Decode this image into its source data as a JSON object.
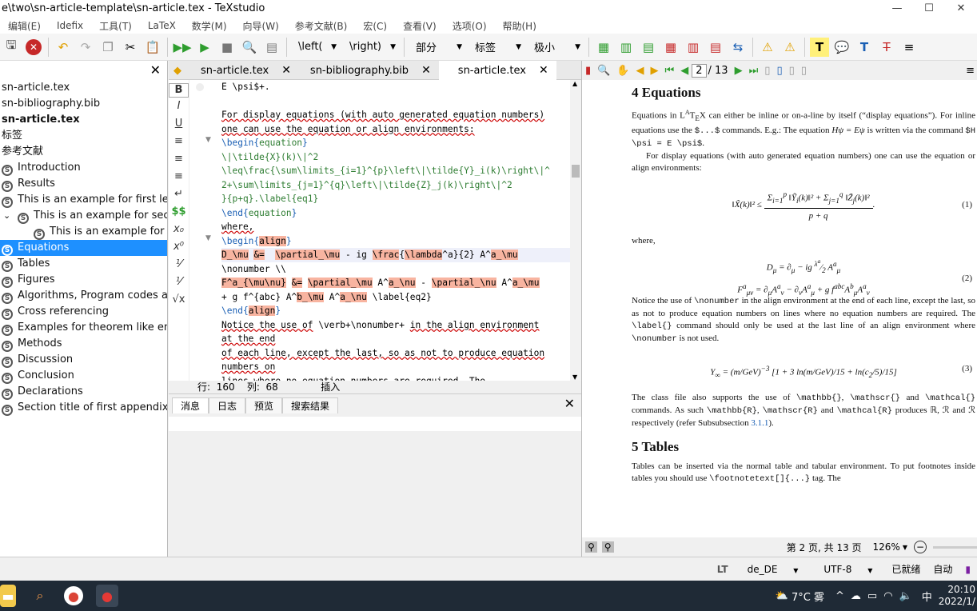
{
  "window": {
    "title": "e\\two\\sn-article-template\\sn-article.tex - TeXstudio",
    "controls": [
      "—",
      "☐",
      "✕"
    ]
  },
  "menu": [
    "编辑(E)",
    "Idefix",
    "工具(T)",
    "LaTeX",
    "数学(M)",
    "向导(W)",
    "参考文献(B)",
    "宏(C)",
    "查看(V)",
    "选项(O)",
    "帮助(H)"
  ],
  "toolbar": {
    "left_combo": "\\left(",
    "right_combo": "\\right)",
    "section_combo": "部分",
    "label_combo": "标签",
    "size_combo": "极小"
  },
  "tree": {
    "items": [
      {
        "label": "sn-article.tex",
        "bold": false,
        "indent": 0,
        "icon": false
      },
      {
        "label": "sn-bibliography.bib",
        "bold": false,
        "indent": 0,
        "icon": false
      },
      {
        "label": "sn-article.tex",
        "bold": true,
        "indent": 0,
        "icon": false
      },
      {
        "label": "标签",
        "bold": false,
        "indent": 0,
        "icon": false
      },
      {
        "label": "参考文献",
        "bold": false,
        "indent": 0,
        "icon": false
      },
      {
        "label": "Introduction",
        "indent": 0,
        "icon": true
      },
      {
        "label": "Results",
        "indent": 0,
        "icon": true
      },
      {
        "label": "This is an example for first lev...",
        "indent": 0,
        "icon": true
      },
      {
        "label": "This is an example for sec...",
        "indent": 1,
        "icon": true,
        "expand": "⌄"
      },
      {
        "label": "This is an example for ...",
        "indent": 2,
        "icon": true
      },
      {
        "label": "Equations",
        "indent": 0,
        "icon": true,
        "selected": true
      },
      {
        "label": "Tables",
        "indent": 0,
        "icon": true
      },
      {
        "label": "Figures",
        "indent": 0,
        "icon": true
      },
      {
        "label": "Algorithms, Program codes a...",
        "indent": 0,
        "icon": true
      },
      {
        "label": "Cross referencing",
        "indent": 0,
        "icon": true
      },
      {
        "label": "Examples for theorem like en...",
        "indent": 0,
        "icon": true
      },
      {
        "label": "Methods",
        "indent": 0,
        "icon": true
      },
      {
        "label": "Discussion",
        "indent": 0,
        "icon": true
      },
      {
        "label": "Conclusion",
        "indent": 0,
        "icon": true
      },
      {
        "label": "Declarations",
        "indent": 0,
        "icon": true
      },
      {
        "label": "Section title of first appendix",
        "indent": 0,
        "icon": true
      }
    ]
  },
  "editor": {
    "tabs": [
      {
        "label": "sn-article.tex",
        "active": false
      },
      {
        "label": "sn-bibliography.bib",
        "active": false
      },
      {
        "label": "sn-article.tex",
        "active": true
      }
    ],
    "status": {
      "line_label": "行:",
      "line": "160",
      "col_label": "列:",
      "col": "68",
      "mode": "插入"
    }
  },
  "messages": {
    "tabs": [
      "消息",
      "日志",
      "预览",
      "搜索结果"
    ]
  },
  "viewer": {
    "page_input": "2",
    "page_total": "/ 13",
    "status_pages": "第 2 页, 共 13 页",
    "zoom": "126%",
    "section4_title": "4  Equations",
    "section5_title": "5  Tables"
  },
  "statusbar": {
    "language": "de_DE",
    "encoding": "UTF-8",
    "ready": "已就绪",
    "auto": "自动"
  },
  "taskbar": {
    "weather": "7°C 雾",
    "ime": "中",
    "time": "20:10",
    "date": "2022/1/"
  }
}
